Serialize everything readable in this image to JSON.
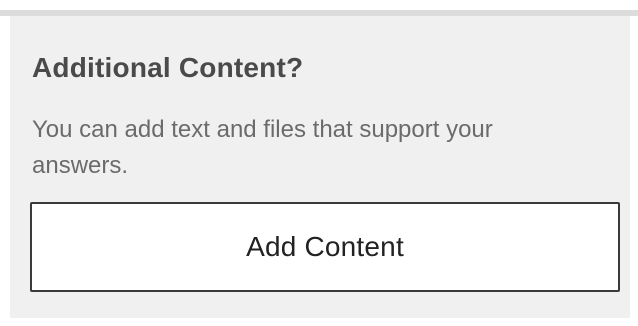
{
  "section": {
    "title": "Additional Content?",
    "description": "You can add text and files that support your answers.",
    "button_label": "Add Content"
  }
}
